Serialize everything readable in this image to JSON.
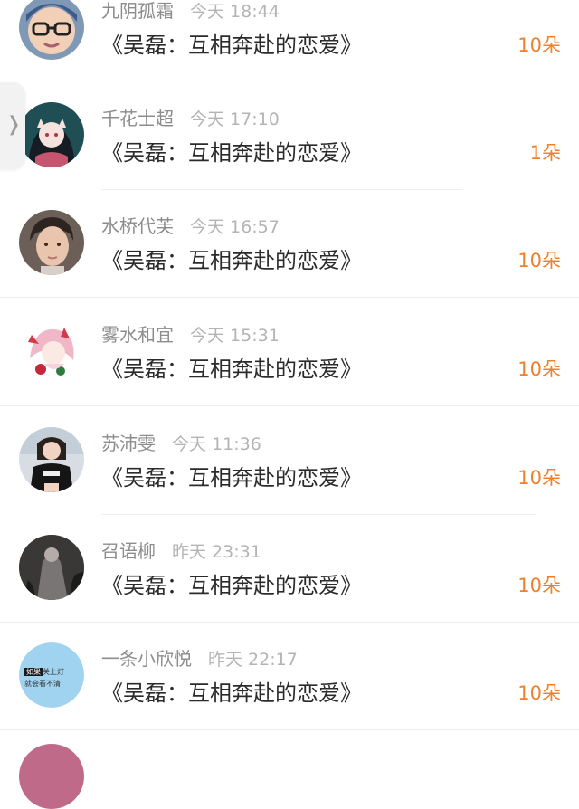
{
  "colors": {
    "username": "#8c8c8c",
    "timestamp": "#b4b4b4",
    "title": "#2b2b2b",
    "gift": "#f0812c",
    "divider": "#eeeeee",
    "background": "#ffffff"
  },
  "side_handle": {
    "icon": "chevron-right-icon",
    "glyph": "❭"
  },
  "comments": [
    {
      "user": "九阴孤霜",
      "time": "今天 18:44",
      "title": "《吴磊：互相奔赴的恋爱》",
      "gift": "10朵",
      "avatar": "avatar-boy-with-glasses"
    },
    {
      "user": "千花士超",
      "time": "今天 17:10",
      "title": "《吴磊：互相奔赴的恋爱》",
      "gift": "1朵",
      "avatar": "avatar-anime-girl-fox-mask"
    },
    {
      "user": "水桥代芙",
      "time": "今天 16:57",
      "title": "《吴磊：互相奔赴的恋爱》",
      "gift": "10朵",
      "avatar": "avatar-young-man"
    },
    {
      "user": "雾水和宜",
      "time": "今天 15:31",
      "title": "《吴磊：互相奔赴的恋爱》",
      "gift": "10朵",
      "avatar": "avatar-anime-girl-pink-hair"
    },
    {
      "user": "苏沛雯",
      "time": "今天 11:36",
      "title": "《吴磊：互相奔赴的恋爱》",
      "gift": "10朵",
      "avatar": "avatar-girl-black-tshirt"
    },
    {
      "user": "召语柳",
      "time": "昨天 23:31",
      "title": "《吴磊：互相奔赴的恋爱》",
      "gift": "10朵",
      "avatar": "avatar-dark-figure"
    },
    {
      "user": "一条小欣悦",
      "time": "昨天 22:17",
      "title": "《吴磊：互相奔赴的恋爱》",
      "gift": "10朵",
      "avatar": "avatar-text-bubble",
      "avatar_text": {
        "tag": "如果",
        "line1": "关上灯",
        "line2": "就会看不清"
      }
    }
  ]
}
